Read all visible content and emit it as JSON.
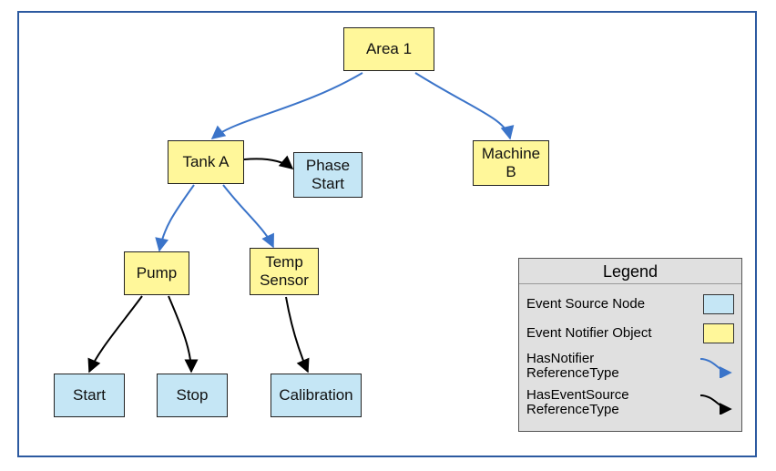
{
  "nodes": {
    "area1": {
      "label": "Area 1",
      "kind": "event-notifier-object"
    },
    "tankA": {
      "label": "Tank A",
      "kind": "event-notifier-object"
    },
    "machineB": {
      "label": "Machine\nB",
      "kind": "event-notifier-object"
    },
    "phaseStart": {
      "label": "Phase\nStart",
      "kind": "event-source-node"
    },
    "pump": {
      "label": "Pump",
      "kind": "event-notifier-object"
    },
    "tempSensor": {
      "label": "Temp\nSensor",
      "kind": "event-notifier-object"
    },
    "start": {
      "label": "Start",
      "kind": "event-source-node"
    },
    "stop": {
      "label": "Stop",
      "kind": "event-source-node"
    },
    "calibration": {
      "label": "Calibration",
      "kind": "event-source-node"
    }
  },
  "edges": [
    {
      "from": "area1",
      "to": "tankA",
      "type": "HasNotifier"
    },
    {
      "from": "area1",
      "to": "machineB",
      "type": "HasNotifier"
    },
    {
      "from": "tankA",
      "to": "phaseStart",
      "type": "HasEventSource"
    },
    {
      "from": "tankA",
      "to": "pump",
      "type": "HasNotifier"
    },
    {
      "from": "tankA",
      "to": "tempSensor",
      "type": "HasNotifier"
    },
    {
      "from": "pump",
      "to": "start",
      "type": "HasEventSource"
    },
    {
      "from": "pump",
      "to": "stop",
      "type": "HasEventSource"
    },
    {
      "from": "tempSensor",
      "to": "calibration",
      "type": "HasEventSource"
    }
  ],
  "legend": {
    "title": "Legend",
    "items": [
      {
        "label": "Event Source Node",
        "style": "swatch-blue"
      },
      {
        "label": "Event Notifier Object",
        "style": "swatch-yellow"
      },
      {
        "label": "HasNotifier\nReferenceType",
        "style": "curve-blue"
      },
      {
        "label": "HasEventSource\nReferenceType",
        "style": "curve-black"
      }
    ]
  },
  "colors": {
    "notifierArrow": "#3b74c9",
    "sourceArrow": "#000000",
    "yellowFill": "#fff79a",
    "blueFill": "#c5e6f5"
  }
}
